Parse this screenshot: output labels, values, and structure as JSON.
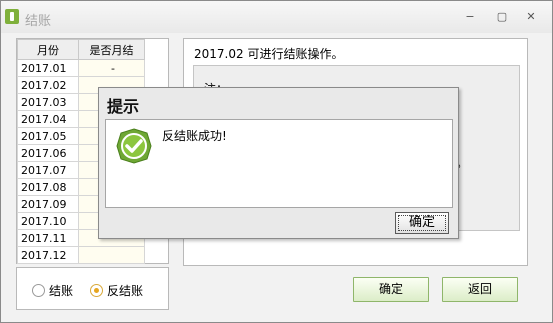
{
  "window": {
    "title": "结账",
    "controls": {
      "minimize": "−",
      "restore": "▢",
      "close": "✕"
    }
  },
  "months_table": {
    "headers": [
      "月份",
      "是否月结"
    ],
    "rows": [
      {
        "month": "2017.01",
        "closed": "-"
      },
      {
        "month": "2017.02",
        "closed": ""
      },
      {
        "month": "2017.03",
        "closed": ""
      },
      {
        "month": "2017.04",
        "closed": ""
      },
      {
        "month": "2017.05",
        "closed": ""
      },
      {
        "month": "2017.06",
        "closed": ""
      },
      {
        "month": "2017.07",
        "closed": ""
      },
      {
        "month": "2017.08",
        "closed": ""
      },
      {
        "month": "2017.09",
        "closed": ""
      },
      {
        "month": "2017.10",
        "closed": ""
      },
      {
        "month": "2017.11",
        "closed": ""
      },
      {
        "month": "2017.12",
        "closed": ""
      }
    ]
  },
  "mode": {
    "options": [
      "结账",
      "反结账"
    ],
    "selected": "反结账"
  },
  "status": {
    "text": "2017.02 可进行结账操作。",
    "note_label": "注：",
    "note_trailing": "。"
  },
  "buttons": {
    "confirm": "确定",
    "back": "返回"
  },
  "dialog": {
    "title": "提示",
    "message": "反结账成功!",
    "ok": "确定",
    "icon": "check-icon"
  },
  "colors": {
    "accent_green": "#7fb03b",
    "button_border": "#8fb66a",
    "radio_selected": "#e6a51e"
  }
}
